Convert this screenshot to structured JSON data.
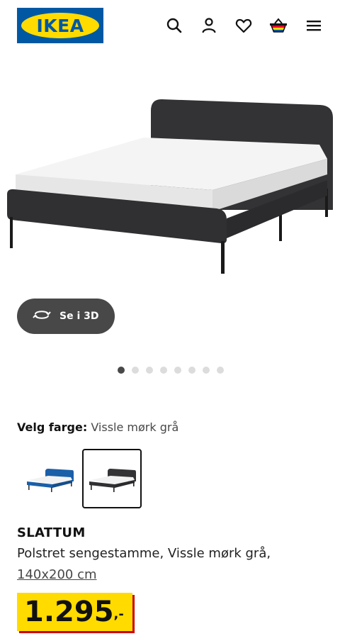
{
  "header": {
    "logo_text": "IKEA",
    "icons": [
      "search-icon",
      "user-icon",
      "heart-icon",
      "basket-icon",
      "menu-icon"
    ]
  },
  "gallery": {
    "view_3d_label": "Se i 3D",
    "image_count": 8,
    "active_index": 0
  },
  "color_select": {
    "label": "Velg farge:",
    "value": "Vissle mørk grå",
    "options": [
      {
        "name": "blue",
        "color": "#1a5fa8",
        "selected": false
      },
      {
        "name": "dark grey",
        "color": "#2e2e2e",
        "selected": true
      }
    ]
  },
  "product": {
    "name": "SLATTUM",
    "description": "Polstret sengestamme, Vissle mørk grå,",
    "size": "140x200 cm",
    "price": "1.295",
    "price_suffix": ",-"
  },
  "colors": {
    "brand_blue": "#0058a3",
    "brand_yellow": "#ffdb00",
    "price_shadow": "#cc0008"
  }
}
